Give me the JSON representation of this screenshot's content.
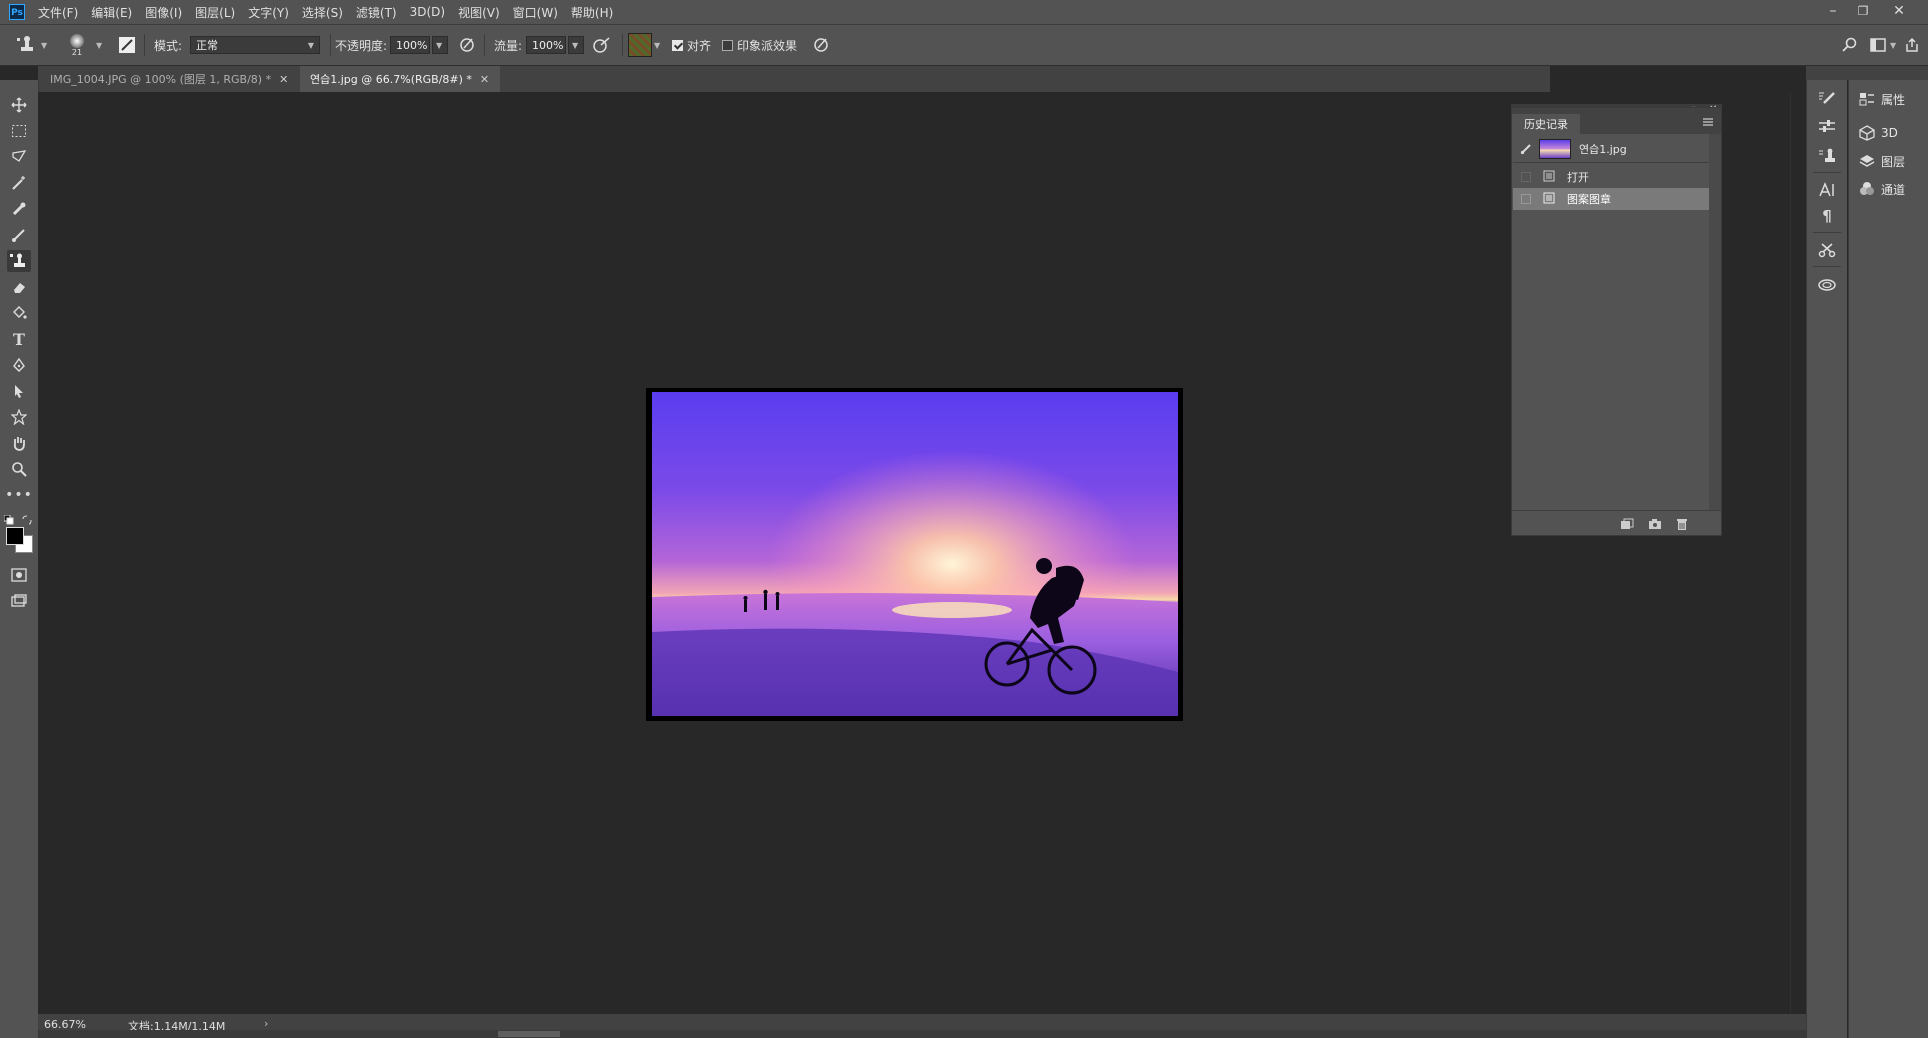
{
  "app": {
    "logo": "Ps"
  },
  "menu": [
    "文件(F)",
    "编辑(E)",
    "图像(I)",
    "图层(L)",
    "文字(Y)",
    "选择(S)",
    "滤镜(T)",
    "3D(D)",
    "视图(V)",
    "窗口(W)",
    "帮助(H)"
  ],
  "window_controls": {
    "minimize": "–",
    "restore": "❐",
    "close": "✕"
  },
  "options": {
    "brush_size": "21",
    "mode_label": "模式:",
    "mode_value": "正常",
    "opacity_label": "不透明度:",
    "opacity_value": "100%",
    "flow_label": "流量:",
    "flow_value": "100%",
    "aligned_label": "对齐",
    "aligned_checked": true,
    "impressionist_label": "印象派效果",
    "impressionist_checked": false
  },
  "tabs": [
    {
      "label": "IMG_1004.JPG @ 100% (图层 1, RGB/8) *",
      "active": false
    },
    {
      "label": "연습1.jpg @ 66.7%(RGB/8#) *",
      "active": true
    }
  ],
  "tools": [
    "move-tool",
    "marquee-tool",
    "lasso-tool",
    "magic-wand-tool",
    "eyedropper-tool",
    "brush-tool",
    "pattern-stamp-tool",
    "eraser-tool",
    "paint-bucket-tool",
    "type-tool",
    "pen-tool",
    "path-selection-tool",
    "custom-shape-tool",
    "hand-tool",
    "zoom-tool",
    "more-tools"
  ],
  "history": {
    "title": "历史记录",
    "snapshot": "연습1.jpg",
    "items": [
      {
        "label": "打开",
        "selected": false
      },
      {
        "label": "图案图章",
        "selected": true
      }
    ]
  },
  "right_panels": [
    {
      "label": "属性",
      "icon": "properties-icon"
    },
    {
      "label": "3D",
      "icon": "cube-icon"
    },
    {
      "label": "图层",
      "icon": "layers-icon"
    },
    {
      "label": "通道",
      "icon": "channels-icon"
    }
  ],
  "status": {
    "zoom": "66.67%",
    "doc": "文档:1.14M/1.14M",
    "arrow": "›"
  },
  "colors": {
    "accent": "#31a8ff",
    "ui_bg": "#535353",
    "canvas_bg": "#282828",
    "selected_row": "#7a7a7a"
  }
}
